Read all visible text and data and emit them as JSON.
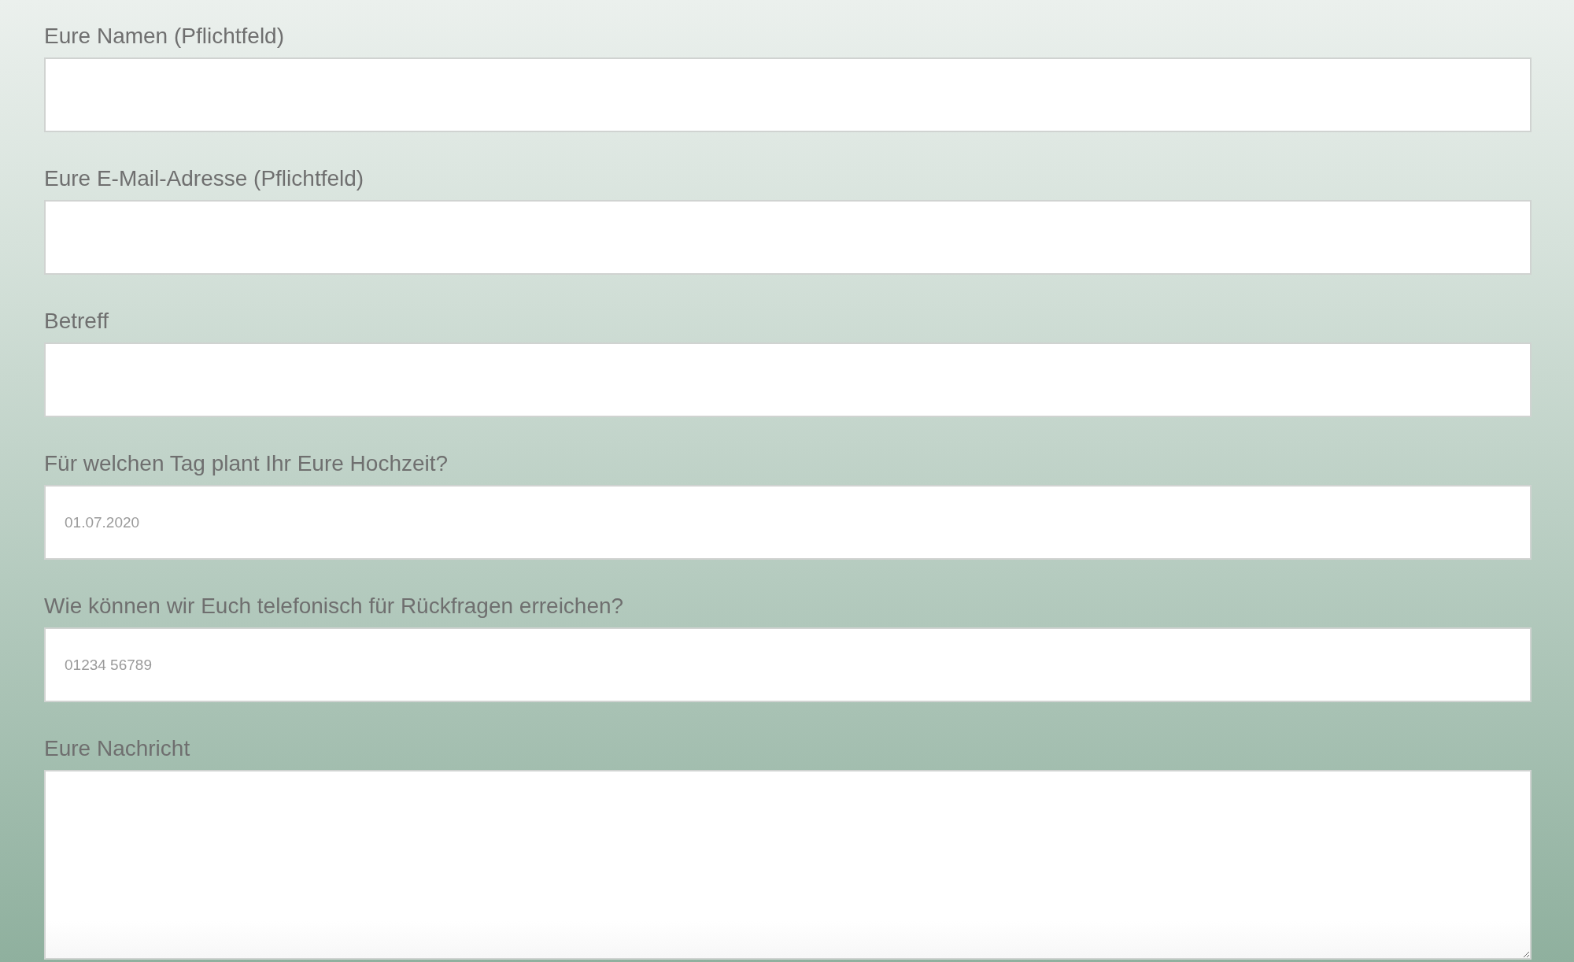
{
  "fields": [
    {
      "kind": "input",
      "label": "Eure Namen (Pflichtfeld)"
    },
    {
      "kind": "input",
      "label": "Eure E-Mail-Adresse (Pflichtfeld)"
    },
    {
      "kind": "input",
      "label": "Betreff"
    },
    {
      "kind": "input",
      "label": "Für welchen Tag plant Ihr Eure Hochzeit?",
      "placeholder": "01.07.2020"
    },
    {
      "kind": "input",
      "label": "Wie können wir Euch telefonisch für Rückfragen erreichen?",
      "placeholder": "01234 56789"
    },
    {
      "kind": "textarea",
      "label": "Eure Nachricht"
    }
  ]
}
